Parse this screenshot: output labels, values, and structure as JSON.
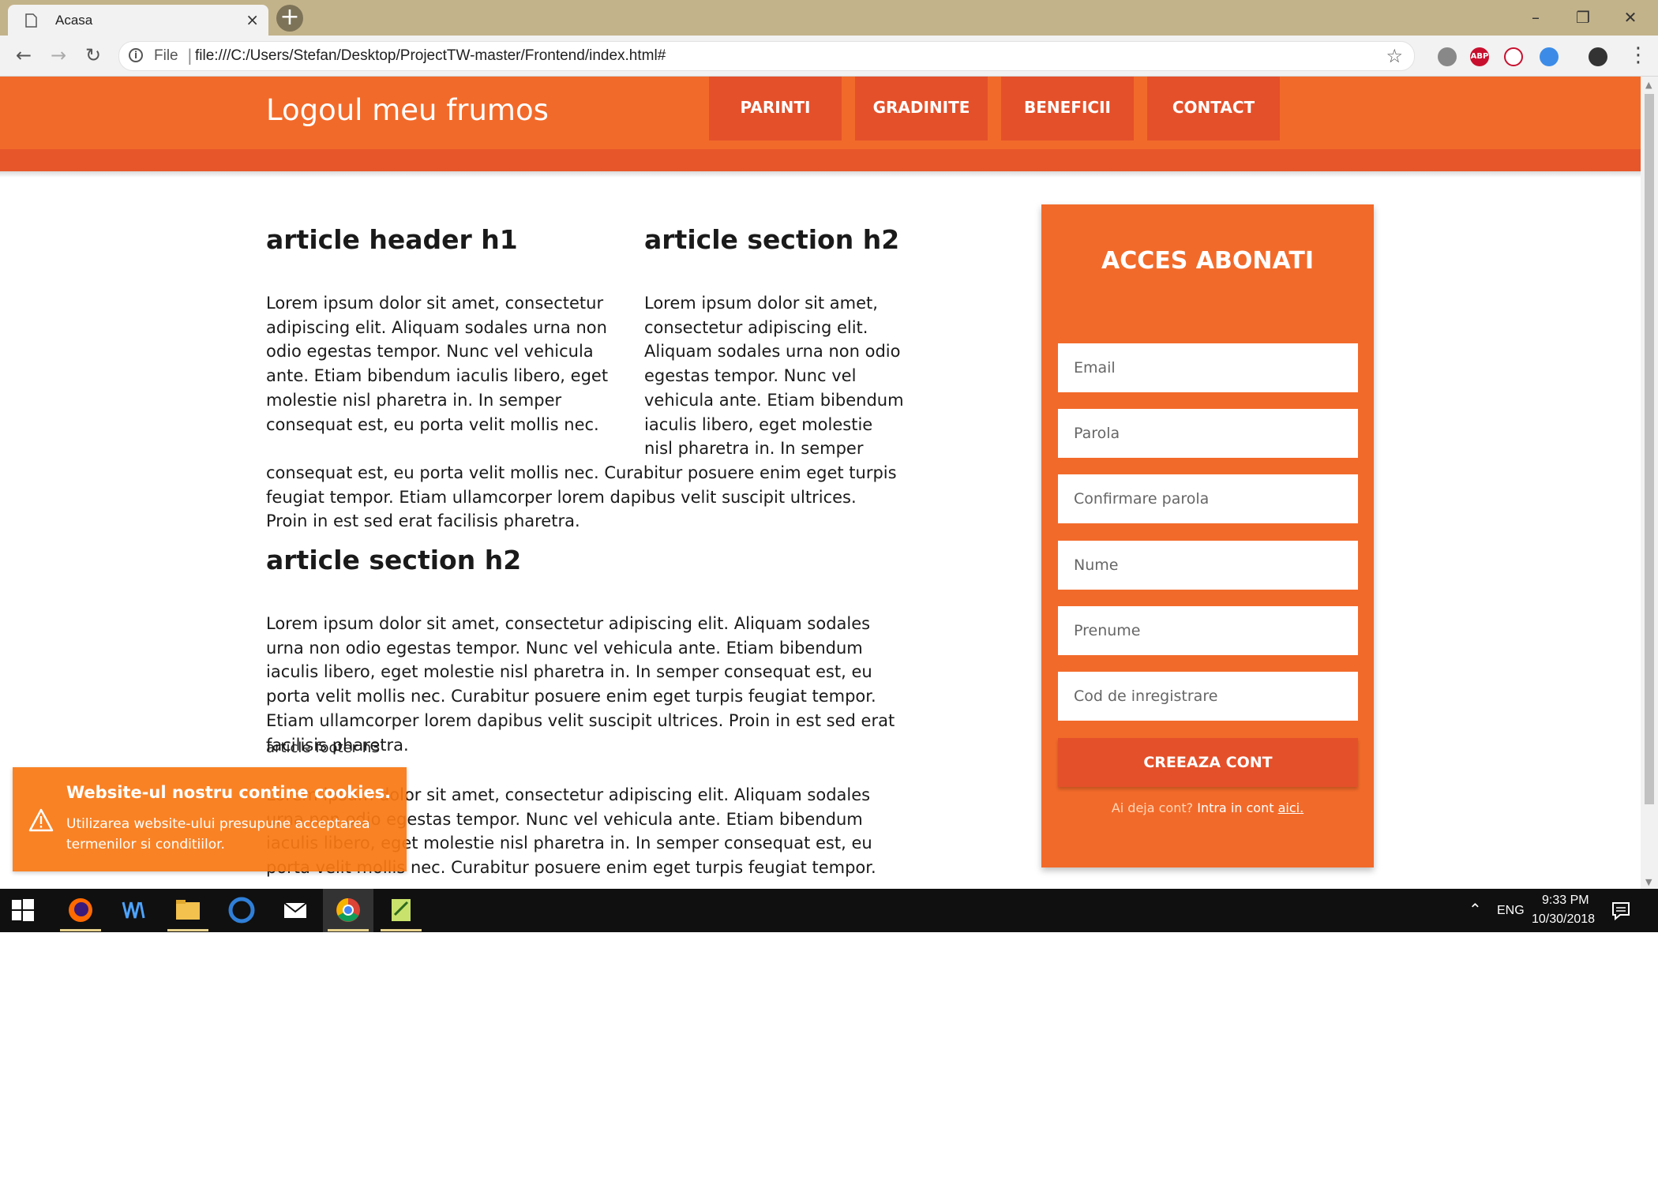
{
  "browser": {
    "tab_title": "Acasa",
    "tab_close": "×",
    "new_tab": "+",
    "url_scheme": "File",
    "url": "file:///C:/Users/Stefan/Desktop/ProjectTW-master/Frontend/index.html#",
    "extensions": [
      "shield-extension",
      "adblock-plus-extension",
      "price-tracker-extension",
      "speed-test-extension",
      "account-extension"
    ]
  },
  "site": {
    "logo": "Logoul meu frumos",
    "nav": [
      "PARINTI",
      "GRADINITE",
      "BENEFICII",
      "CONTACT"
    ],
    "colors": {
      "primary": "#f26a2a",
      "dark": "#e4502a",
      "cookie": "#f97814"
    }
  },
  "article": {
    "header_h1": "article header h1",
    "header_text": "Lorem ipsum dolor sit amet, consectetur adipiscing elit. Aliquam sodales urna non odio egestas tempor. Nunc vel vehicula ante. Etiam bibendum iaculis libero, eget molestie nisl pharetra in. In semper consequat est, eu porta velit mollis nec.",
    "aside_h2": "article section h2",
    "aside_text": "Lorem ipsum dolor sit amet, consectetur adipiscing elit. Aliquam sodales urna non odio egestas tempor. Nunc vel vehicula ante. Etiam bibendum iaculis libero, eget molestie nisl pharetra in. In semper",
    "aside_continuation": "consequat est, eu porta velit mollis nec. Curabitur posuere enim eget turpis feugiat tempor. Etiam ullamcorper lorem dapibus velit suscipit ultrices. Proin in est sed erat facilisis pharetra.",
    "section_h2": "article section h2",
    "section_text": "Lorem ipsum dolor sit amet, consectetur adipiscing elit. Aliquam sodales urna non odio egestas tempor. Nunc vel vehicula ante. Etiam bibendum iaculis libero, eget molestie nisl pharetra in. In semper consequat est, eu porta velit mollis nec. Curabitur posuere enim eget turpis feugiat tempor. Etiam ullamcorper lorem dapibus velit suscipit ultrices. Proin in est sed erat facilisis pharetra.",
    "footer_h3": "article footer h3",
    "footer_text": "Lorem ipsum dolor sit amet, consectetur adipiscing elit. Aliquam sodales urna non odio egestas tempor. Nunc vel vehicula ante. Etiam bibendum iaculis libero, eget molestie nisl pharetra in. In semper consequat est, eu porta velit mollis nec. Curabitur posuere enim eget turpis feugiat tempor."
  },
  "signup": {
    "title": "ACCES ABONATI",
    "placeholders": [
      "Email",
      "Parola",
      "Confirmare parola",
      "Nume",
      "Prenume",
      "Cod de inregistrare"
    ],
    "submit": "CREEAZA CONT",
    "login_question": "Ai deja cont?",
    "login_prefix": "Intra in cont",
    "login_link": "aici."
  },
  "cookie": {
    "title": "Website-ul nostru contine cookies.",
    "text": "Utilizarea website-ului presupune acceptarea termenilor si conditiilor."
  },
  "taskbar": {
    "apps": [
      "windows-start",
      "firefox",
      "wacom",
      "file-explorer",
      "ccleaner",
      "mail",
      "chrome",
      "notepad-plus"
    ],
    "language": "ENG",
    "time": "9:33 PM",
    "date": "10/30/2018"
  }
}
